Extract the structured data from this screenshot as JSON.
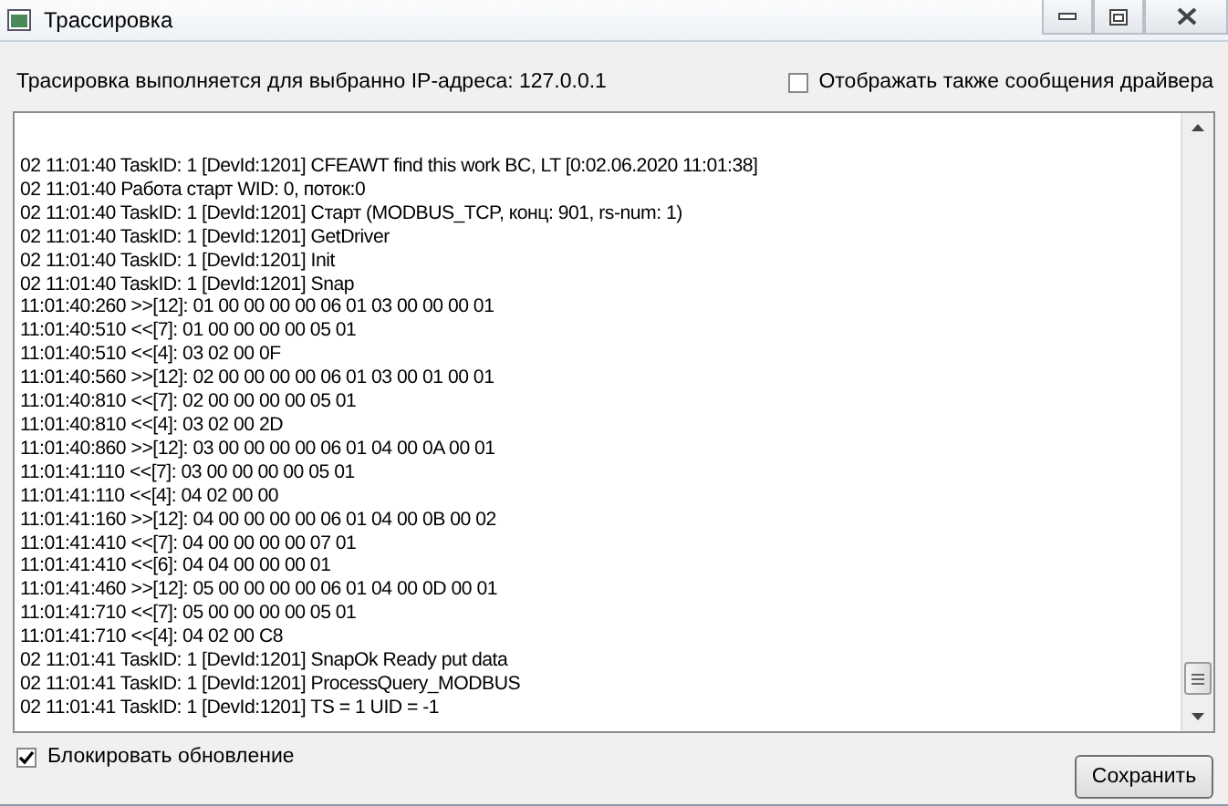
{
  "window": {
    "title": "Трассировка"
  },
  "info": "Трасировка выполняется для выбранно IP-адреса: 127.0.0.1",
  "driver_messages": {
    "label": "Отображать также сообщения драйвера",
    "checked": false
  },
  "log": [
    "02 11:01:40 TaskID: 1 [DevId:1201] CFEAWT find this work BC, LT [0:02.06.2020 11:01:38]",
    "02 11:01:40 Работа старт WID: 0, поток:0",
    "02 11:01:40 TaskID: 1 [DevId:1201] Старт (MODBUS_TCP, конц: 901, rs-num: 1)",
    "02 11:01:40 TaskID: 1 [DevId:1201] GetDriver",
    "02 11:01:40 TaskID: 1 [DevId:1201] Init",
    "02 11:01:40 TaskID: 1 [DevId:1201] Snap",
    "11:01:40:260 >>[12]: 01 00 00 00 00 06 01 03 00 00 00 01",
    "11:01:40:510 <<[7]: 01 00 00 00 00 05 01",
    "11:01:40:510 <<[4]: 03 02 00 0F",
    "11:01:40:560 >>[12]: 02 00 00 00 00 06 01 03 00 01 00 01",
    "11:01:40:810 <<[7]: 02 00 00 00 00 05 01",
    "11:01:40:810 <<[4]: 03 02 00 2D",
    "11:01:40:860 >>[12]: 03 00 00 00 00 06 01 04 00 0A 00 01",
    "11:01:41:110 <<[7]: 03 00 00 00 00 05 01",
    "11:01:41:110 <<[4]: 04 02 00 00",
    "11:01:41:160 >>[12]: 04 00 00 00 00 06 01 04 00 0B 00 02",
    "11:01:41:410 <<[7]: 04 00 00 00 00 07 01",
    "11:01:41:410 <<[6]: 04 04 00 00 00 01",
    "11:01:41:460 >>[12]: 05 00 00 00 00 06 01 04 00 0D 00 01",
    "11:01:41:710 <<[7]: 05 00 00 00 00 05 01",
    "11:01:41:710 <<[4]: 04 02 00 C8",
    "02 11:01:41 TaskID: 1 [DevId:1201] SnapOk Ready put data",
    "02 11:01:41 TaskID: 1 [DevId:1201] ProcessQuery_MODBUS",
    "02 11:01:41 TaskID: 1 [DevId:1201] TS = 1 UID = -1"
  ],
  "block_updates": {
    "label": "Блокировать обновление",
    "checked": true
  },
  "save_button": "Сохранить"
}
